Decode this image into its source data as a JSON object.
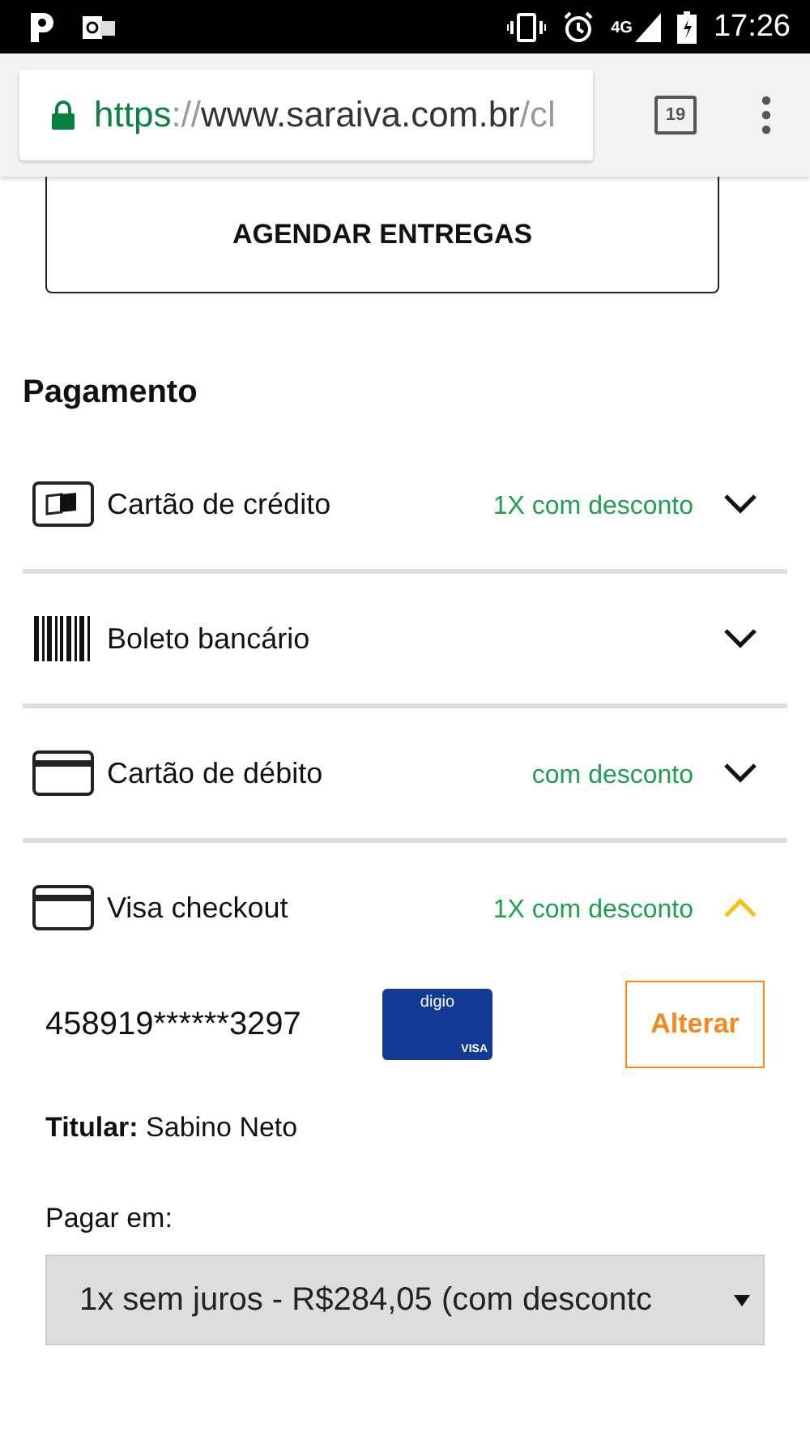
{
  "status_bar": {
    "network": "4G",
    "time": "17:26"
  },
  "browser": {
    "url": {
      "scheme": "https",
      "separator": "://",
      "host": "www.saraiva.com.br",
      "path": "/cl"
    },
    "tab_count": "19"
  },
  "schedule_button": "AGENDAR ENTREGAS",
  "section_title": "Pagamento",
  "payment_methods": [
    {
      "kind": "credit",
      "label": "Cartão de crédito",
      "offer": "1X com desconto",
      "expanded": false
    },
    {
      "kind": "boleto",
      "label": "Boleto bancário",
      "expanded": false
    },
    {
      "kind": "card",
      "label": "Cartão de débito",
      "offer": "com desconto",
      "expanded": false
    },
    {
      "kind": "card",
      "label": "Visa checkout",
      "offer": "1X com desconto",
      "expanded": true
    }
  ],
  "card": {
    "number": "458919******3297",
    "brand": "digio",
    "network": "VISA",
    "change_button": "Alterar",
    "holder": "**Titular:** Sabino Neto",
    "installments_label": "Pagar em:",
    "installments_value": "1x sem juros - R$284,05 (com descontc"
  }
}
